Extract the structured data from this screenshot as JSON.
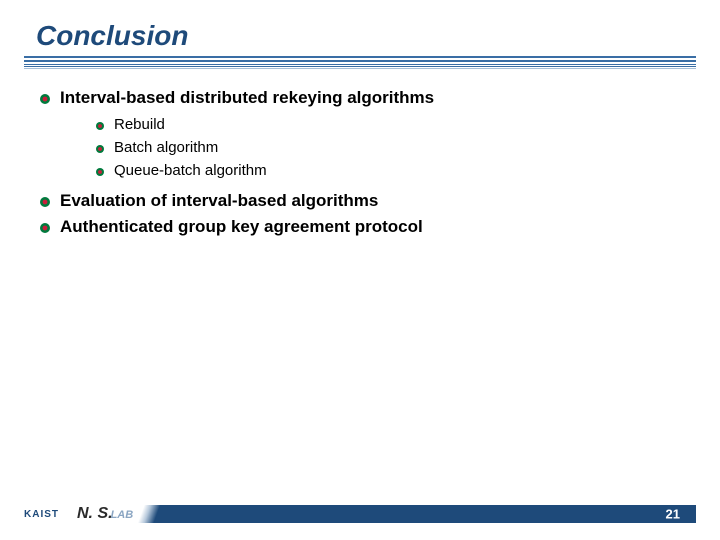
{
  "title": "Conclusion",
  "bullets": {
    "item1": "Interval-based distributed rekeying algorithms",
    "sub": {
      "a": "Rebuild",
      "b": "Batch algorithm",
      "c": "Queue-batch algorithm"
    },
    "item2": "Evaluation of interval-based algorithms",
    "item3": "Authenticated group key agreement protocol"
  },
  "footer": {
    "org": "KAIST",
    "lab_main": "N. S",
    "lab_sub": "LAB",
    "page": "21"
  }
}
